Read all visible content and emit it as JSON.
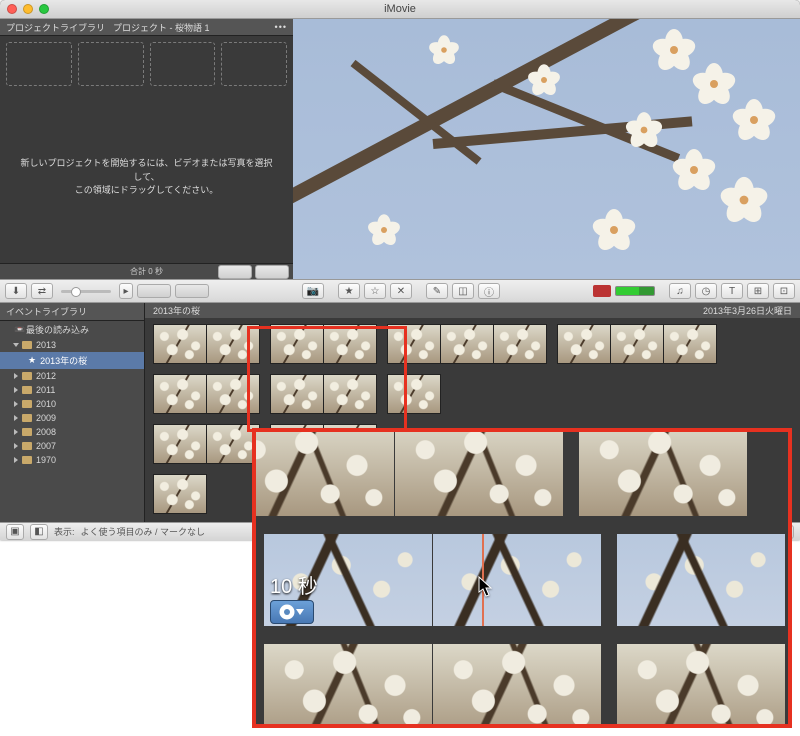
{
  "窗口": {
    "タイトル": "iMovie"
  },
  "プロジェクト": {
    "ライブラリラベル": "プロジェクトライブラリ",
    "現在プロジェクト": "プロジェクト - 桜物語 1",
    "メッセージ行1": "新しいプロジェクトを開始するには、ビデオまたは写真を選択して、",
    "メッセージ行2": "この領域にドラッグしてください。",
    "フッタ": "合計 0 秒"
  },
  "サイドバー": {
    "見出し": "イベントライブラリ",
    "最近": "最後の読み込み",
    "年": [
      "2013",
      "2012",
      "2011",
      "2010",
      "2009",
      "2008",
      "2007",
      "1970"
    ],
    "選択イベント": "2013年の桜"
  },
  "ブラウザ": {
    "見出し": "2013年の桜",
    "日付": "2013年3月26日火曜日"
  },
  "ボトムバー": {
    "表示ラベル": "表示:",
    "フィルタ": "よく使う項目のみ / マークなし"
  },
  "ズーム": {
    "時間": "10 秒"
  },
  "色": {
    "赤枠": "#e63120",
    "選択": "#5b7aa8"
  }
}
